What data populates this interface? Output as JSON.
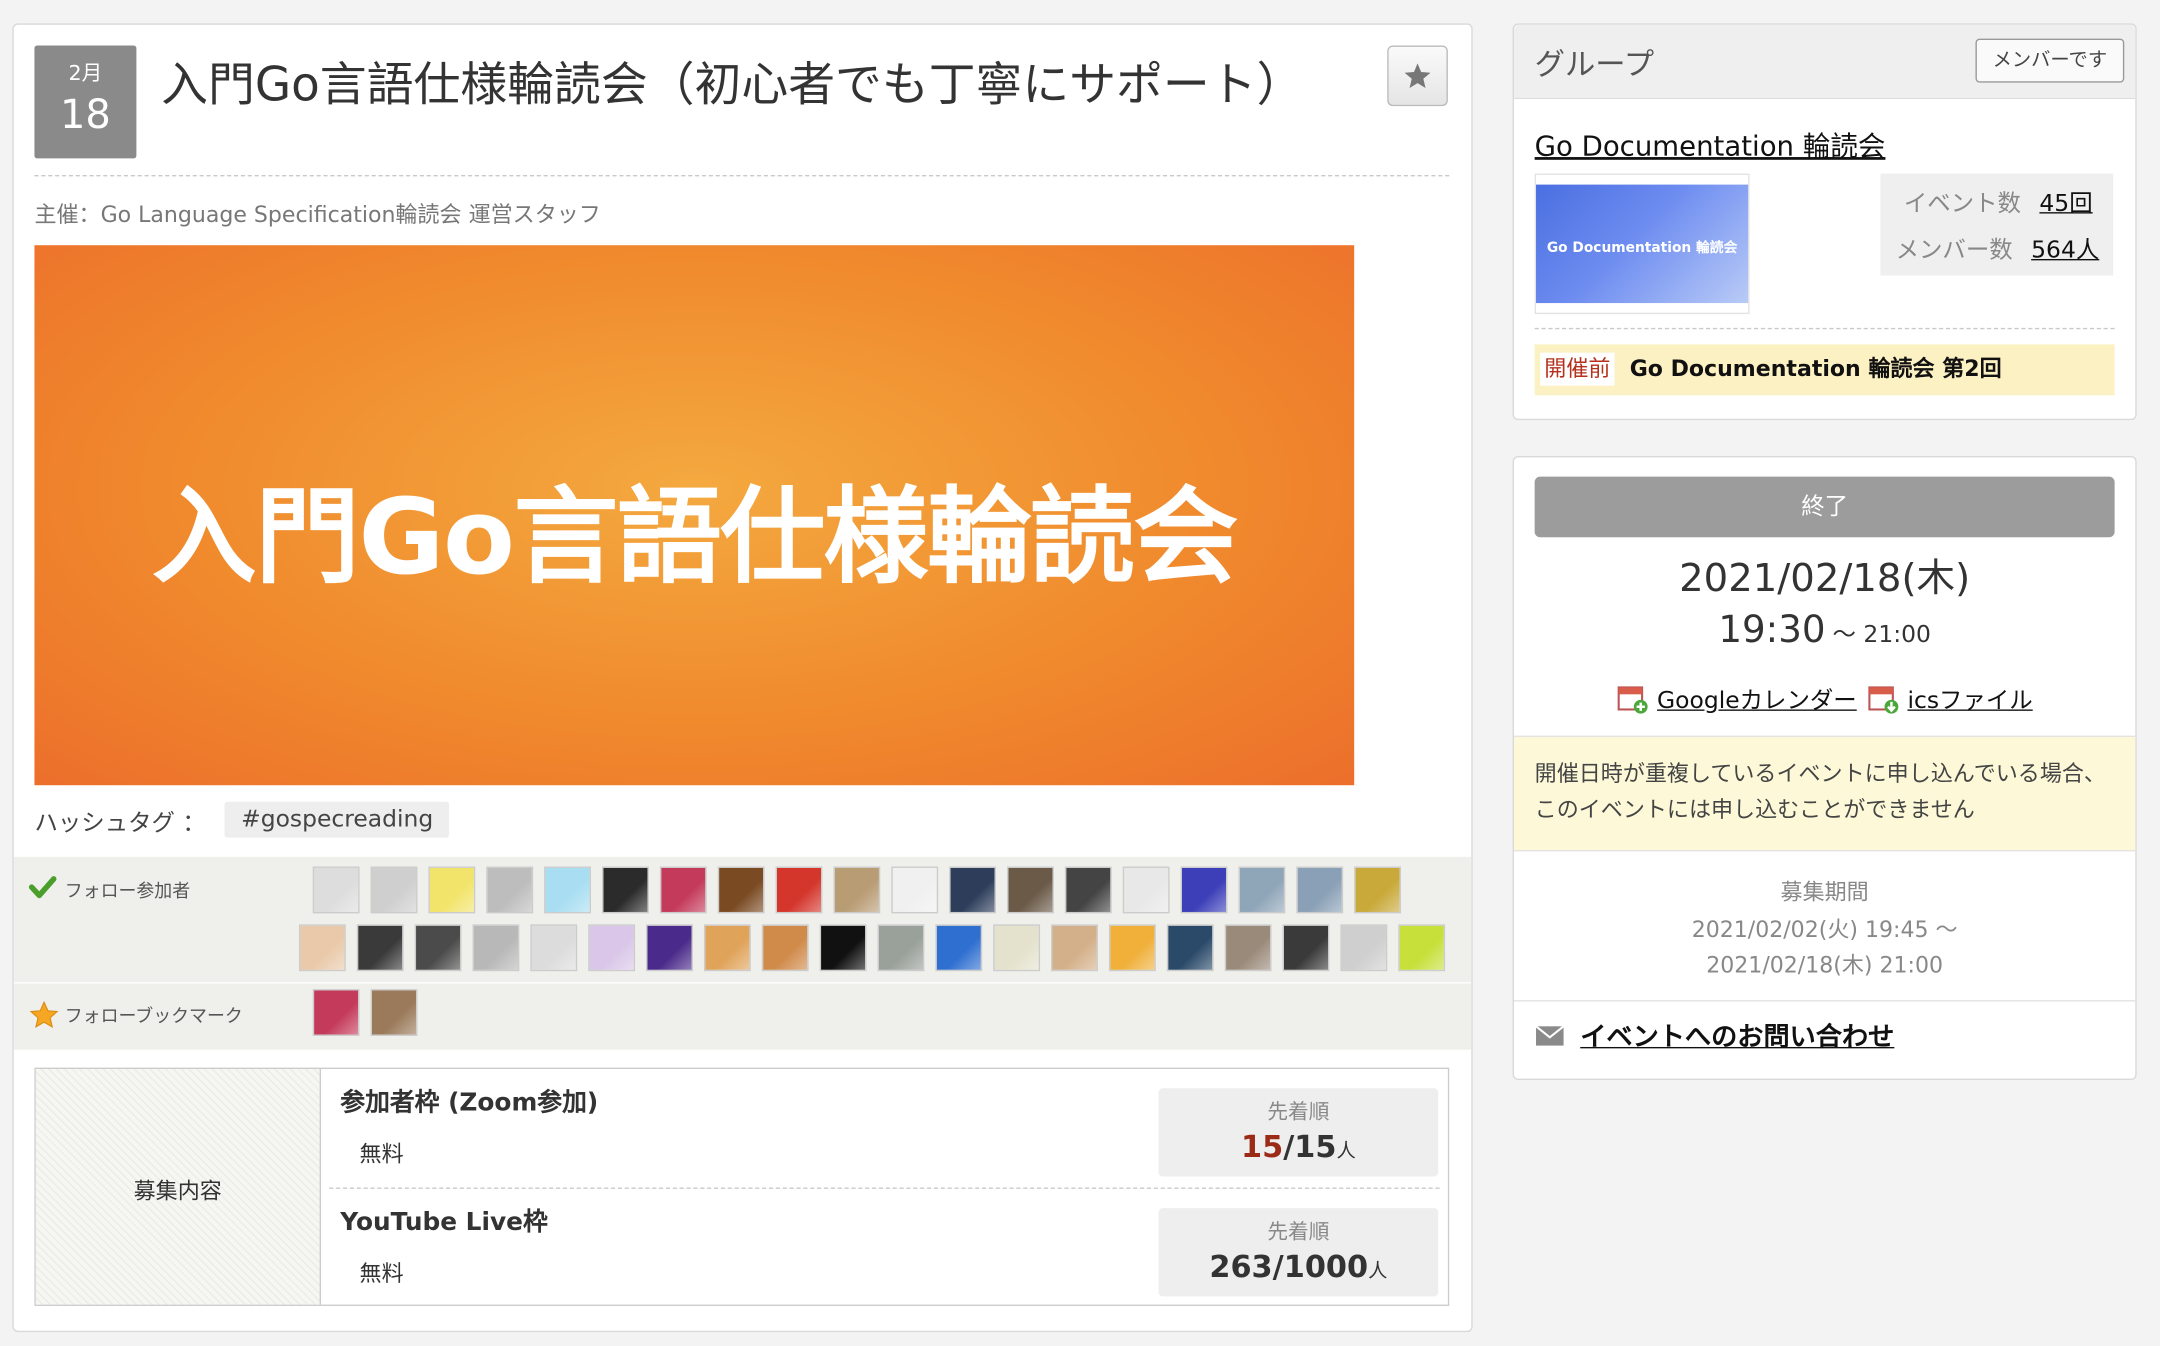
{
  "event": {
    "date_month": "2月",
    "date_day": "18",
    "title": "入門Go言語仕様輪読会（初心者でも丁寧にサポート）",
    "organizer": "主催：Go Language Specification輪読会 運営スタッフ",
    "banner_text": "入門Go言語仕様輪読会",
    "hashtag_label": "ハッシュタグ ：",
    "hashtag": "#gospecreading"
  },
  "followers": {
    "participants_label": "フォロー参加者",
    "bookmark_label": "フォローブックマーク",
    "participant_count": 40,
    "bookmark_count": 2
  },
  "recruitment": {
    "label": "募集内容",
    "tickets": [
      {
        "name": "参加者枠 (Zoom参加)",
        "price": "無料",
        "method": "先着順",
        "current": "15",
        "capacity": "15",
        "unit": "人"
      },
      {
        "name": "YouTube Live枠",
        "price": "無料",
        "method": "先着順",
        "current": "263",
        "capacity": "1000",
        "unit": "人"
      }
    ]
  },
  "group": {
    "heading": "グループ",
    "member_badge": "メンバーです",
    "name": "Go Documentation 輪読会",
    "thumb_text": "Go Documentation 輪読会",
    "events_label": "イベント数",
    "events_value": "45回",
    "members_label": "メンバー数",
    "members_value": "564人",
    "upcoming_status": "開催前",
    "upcoming_title": "Go Documentation 輪読会 第2回"
  },
  "schedule": {
    "status_button": "終了",
    "date": "2021/02/18(木)",
    "start_time": "19:30",
    "end_time": "〜 21:00",
    "gcal_label": "Googleカレンダー",
    "ics_label": "icsファイル",
    "notice": "開催日時が重複しているイベントに申し込んでいる場合、このイベントには申し込むことができません",
    "period_label": "募集期間",
    "period_start": "2021/02/02(火) 19:45 〜",
    "period_end": "2021/02/18(木) 21:00",
    "contact_label": "イベントへのお問い合わせ"
  },
  "colors": {
    "accent_red": "#9b2a17",
    "status_gray": "#9c9c9c",
    "banner_orange": "#f0892e",
    "notice_yellow": "#fdf9d8"
  }
}
